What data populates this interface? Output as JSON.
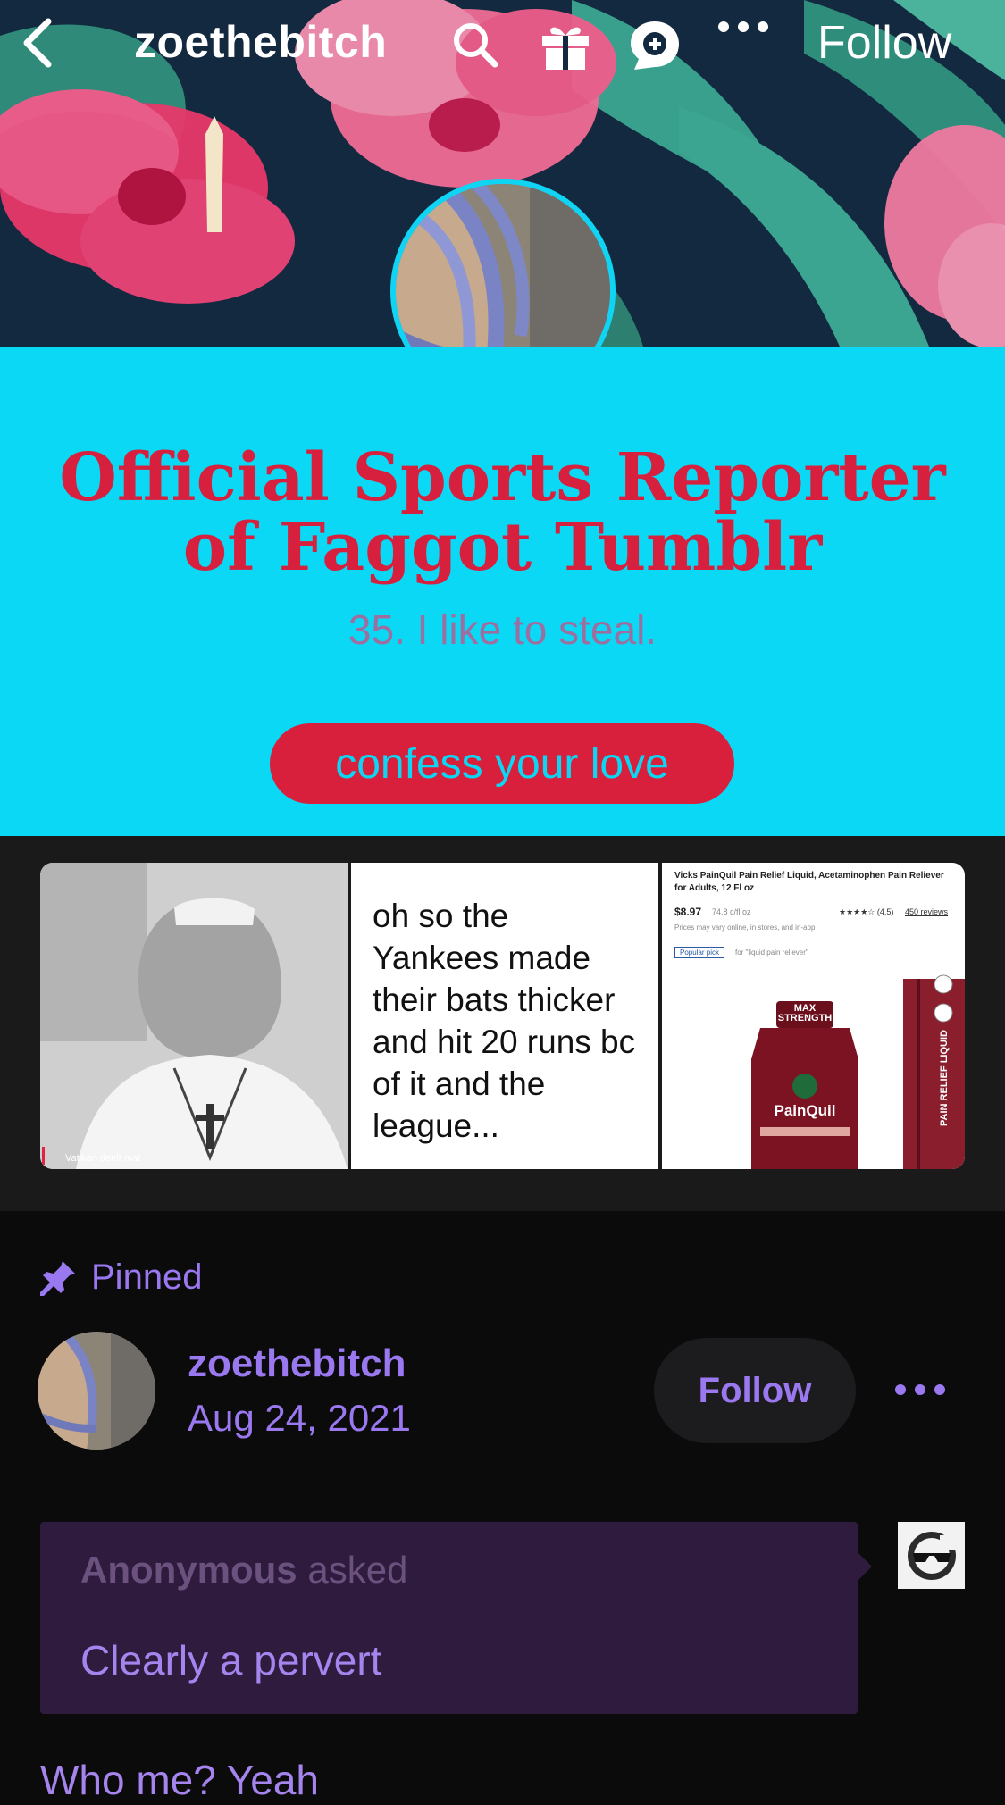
{
  "header": {
    "blog_name": "zoethebitch",
    "follow_label": "Follow",
    "icons": [
      "back-chevron-icon",
      "search-icon",
      "gift-icon",
      "ask-bubble-icon",
      "more-horizontal-icon"
    ]
  },
  "profile": {
    "title": "Official Sports Reporter of Faggot Tumblr",
    "description": "35. I like to steal.",
    "ask_button_label": "confess your love",
    "colors": {
      "accent_bg": "#0ad8f5",
      "title_color": "#d6203d",
      "button_bg": "#d81f3c",
      "description_color": "#9c6fa0"
    }
  },
  "grid": {
    "tiles": [
      {
        "type": "photo",
        "caption": "Vatikan deelt mat"
      },
      {
        "type": "text",
        "text": "oh so the Yankees made their bats thicker and hit 20 runs bc of it and the league..."
      },
      {
        "type": "product",
        "product_title": "Vicks PainQuil Pain Relief Liquid, Acetaminophen Pain Reliever for Adults, 12 Fl oz",
        "price": "$8.97",
        "unit_price": "74.8 c/fl oz",
        "rating": "★★★★☆ (4.5)",
        "reviews": "450 reviews",
        "note": "Prices may vary online, in stores, and in-app",
        "badge": "Popular pick",
        "badge_note": "for \"liquid pain reliever\"",
        "brand": "PainQuil",
        "box_text": "PAIN RELIEF LIQUID",
        "max_label": "MAX STRENGTH"
      }
    ]
  },
  "post": {
    "pinned_label": "Pinned",
    "author": "zoethebitch",
    "date": "Aug 24, 2021",
    "follow_label": "Follow",
    "ask": {
      "asker": "Anonymous",
      "asked_word": "asked",
      "question": "Clearly a pervert"
    },
    "answer": "Who me? Yeah",
    "colors": {
      "accent": "#9a78f0",
      "ask_bg": "#2e1b3d"
    }
  }
}
